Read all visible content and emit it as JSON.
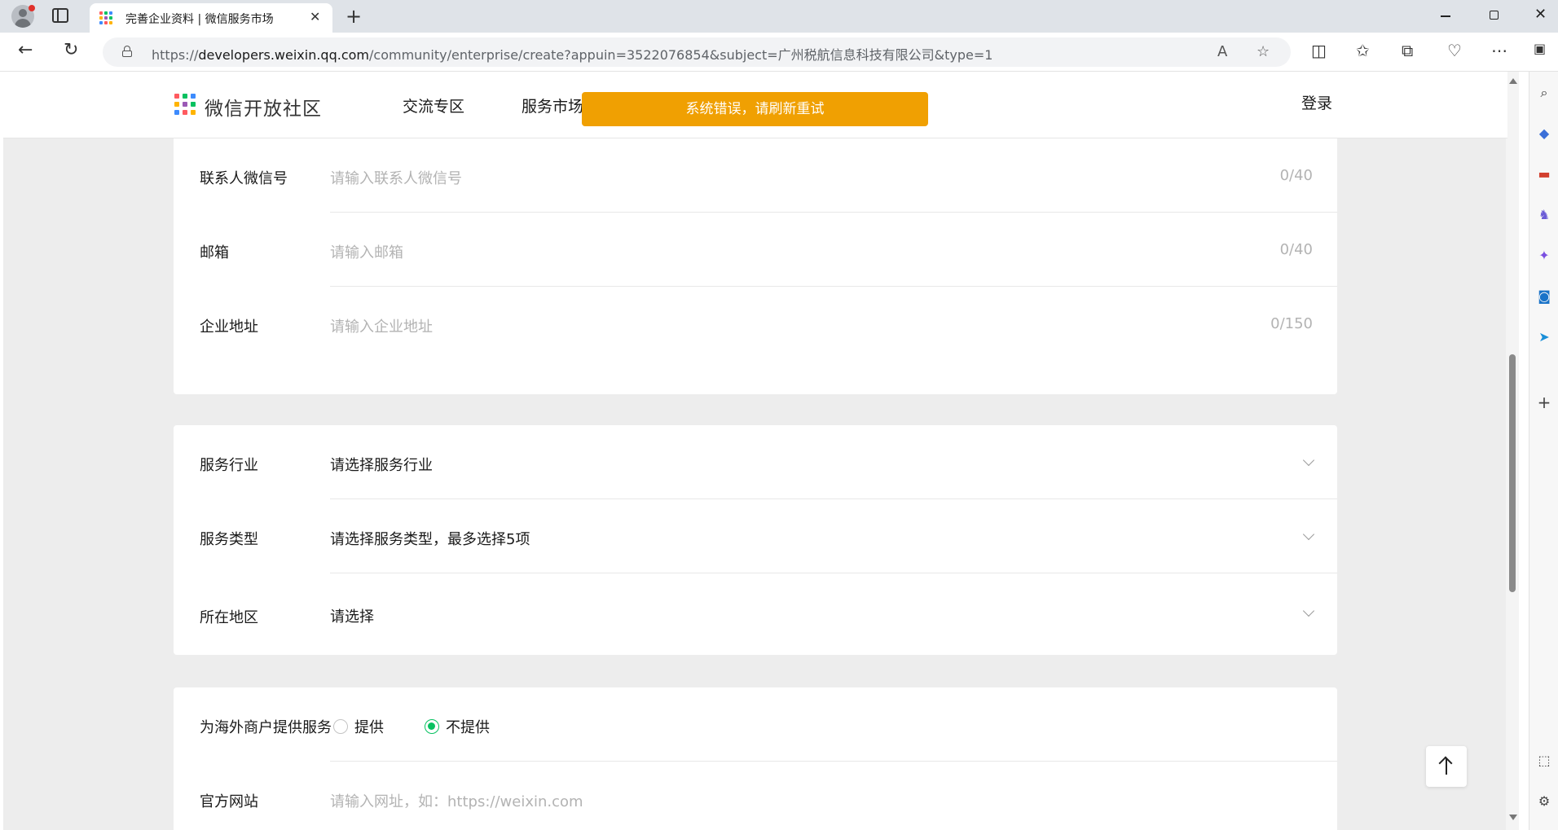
{
  "browser": {
    "tab_title": "完善企业资料 | 微信服务市场",
    "tab_close": "✕",
    "new_tab": "+",
    "url_prefix": "https://",
    "url_host": "developers.weixin.qq.com",
    "url_path": "/community/enterprise/create?appuin=3522076854&subject=广州税航信息科技有限公司&type=1",
    "read_aloud": "A",
    "back": "←",
    "reload": "↻"
  },
  "header": {
    "logo_text": "微信开放社区",
    "nav": [
      "交流专区",
      "服务市场"
    ],
    "login": "登录",
    "toast": "系统错误，请刷新重试"
  },
  "card1": {
    "rows": [
      {
        "label": "联系人微信号",
        "placeholder": "请输入联系人微信号",
        "counter": "0/40"
      },
      {
        "label": "邮箱",
        "placeholder": "请输入邮箱",
        "counter": "0/40"
      },
      {
        "label": "企业地址",
        "placeholder": "请输入企业地址",
        "counter": "0/150"
      }
    ]
  },
  "card2": {
    "rows": [
      {
        "label": "服务行业",
        "value": "请选择服务行业"
      },
      {
        "label": "服务类型",
        "value": "请选择服务类型，最多选择5项"
      },
      {
        "label": "所在地区",
        "value": "请选择"
      }
    ]
  },
  "card3": {
    "overseas_label": "为海外商户提供服务",
    "options": [
      "提供",
      "不提供"
    ],
    "selected": "不提供",
    "website_label": "官方网站",
    "website_placeholder": "请输入网址，如：https://weixin.com"
  },
  "colors": {
    "brand_green": "#07c160",
    "toast_bg": "#f0a002"
  },
  "icons": [
    "profile-icon",
    "tab-actions-icon",
    "lock-icon",
    "read-aloud-icon",
    "favorite-icon",
    "split-screen-icon",
    "favorites-icon",
    "collections-icon",
    "extension-icon",
    "more-icon",
    "sidebar-icon",
    "search-icon",
    "tag-icon",
    "toolbox-icon",
    "chess-icon",
    "copilot-icon",
    "outlook-icon",
    "send-icon",
    "add-icon",
    "screenshot-icon",
    "settings-icon",
    "chevron-down-icon",
    "arrow-up-icon"
  ]
}
